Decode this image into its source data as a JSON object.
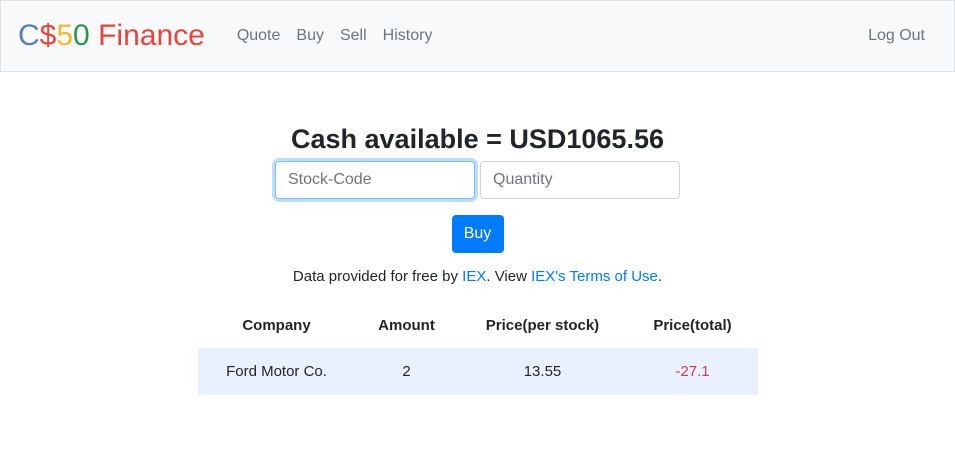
{
  "navbar": {
    "brand": {
      "c": "C",
      "dollar": "$",
      "five": "5",
      "zero": "0",
      "finance": "Finance"
    },
    "links": [
      {
        "label": "Quote"
      },
      {
        "label": "Buy"
      },
      {
        "label": "Sell"
      },
      {
        "label": "History"
      }
    ],
    "logout": "Log Out"
  },
  "main": {
    "cash_text": "Cash available = USD1065.56",
    "stock_input": {
      "value": "",
      "placeholder": "Stock-Code"
    },
    "quantity_input": {
      "value": "",
      "placeholder": "Quantity"
    },
    "buy_label": "Buy",
    "credit": {
      "prefix": "Data provided for free by ",
      "iex": "IEX",
      "middle": ". View ",
      "terms": "IEX's Terms of Use",
      "suffix": "."
    }
  },
  "table": {
    "headers": [
      "Company",
      "Amount",
      "Price(per stock)",
      "Price(total)"
    ],
    "rows": [
      {
        "company": "Ford Motor Co.",
        "amount": "2",
        "price": "13.55",
        "total": "-27.1"
      }
    ]
  },
  "colors": {
    "accent": "#007bff",
    "negative": "#dc3545",
    "row_highlight": "#e8f1fd",
    "brand_blue": "#537fbe",
    "brand_red": "#ea433b",
    "brand_yellow": "#f5b82e",
    "brand_green": "#2e944b"
  }
}
